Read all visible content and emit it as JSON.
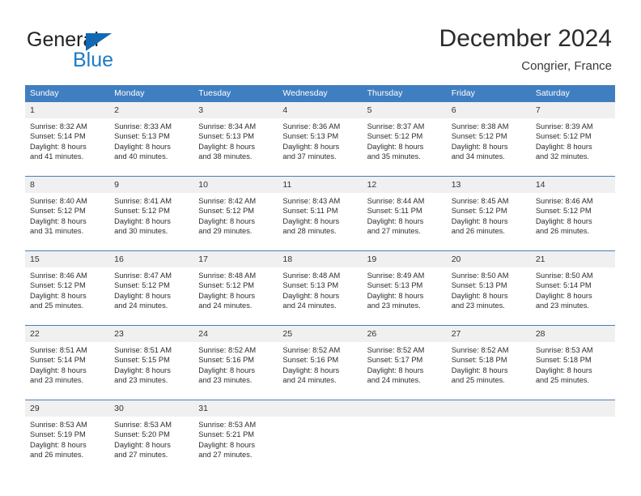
{
  "brand": {
    "name_part1": "General",
    "name_part2": "Blue",
    "accent_color": "#1268b3",
    "logo_icon": "triangle-flag-icon"
  },
  "header": {
    "title": "December 2024",
    "subtitle": "Congrier, France"
  },
  "calendar": {
    "header_bg": "#3f7fc1",
    "daynum_bg": "#f0f0f0",
    "row_border": "#4a7fb5",
    "weekday_headers": [
      "Sunday",
      "Monday",
      "Tuesday",
      "Wednesday",
      "Thursday",
      "Friday",
      "Saturday"
    ],
    "weeks": [
      [
        {
          "day": "1",
          "sunrise": "Sunrise: 8:32 AM",
          "sunset": "Sunset: 5:14 PM",
          "daylight1": "Daylight: 8 hours",
          "daylight2": "and 41 minutes."
        },
        {
          "day": "2",
          "sunrise": "Sunrise: 8:33 AM",
          "sunset": "Sunset: 5:13 PM",
          "daylight1": "Daylight: 8 hours",
          "daylight2": "and 40 minutes."
        },
        {
          "day": "3",
          "sunrise": "Sunrise: 8:34 AM",
          "sunset": "Sunset: 5:13 PM",
          "daylight1": "Daylight: 8 hours",
          "daylight2": "and 38 minutes."
        },
        {
          "day": "4",
          "sunrise": "Sunrise: 8:36 AM",
          "sunset": "Sunset: 5:13 PM",
          "daylight1": "Daylight: 8 hours",
          "daylight2": "and 37 minutes."
        },
        {
          "day": "5",
          "sunrise": "Sunrise: 8:37 AM",
          "sunset": "Sunset: 5:12 PM",
          "daylight1": "Daylight: 8 hours",
          "daylight2": "and 35 minutes."
        },
        {
          "day": "6",
          "sunrise": "Sunrise: 8:38 AM",
          "sunset": "Sunset: 5:12 PM",
          "daylight1": "Daylight: 8 hours",
          "daylight2": "and 34 minutes."
        },
        {
          "day": "7",
          "sunrise": "Sunrise: 8:39 AM",
          "sunset": "Sunset: 5:12 PM",
          "daylight1": "Daylight: 8 hours",
          "daylight2": "and 32 minutes."
        }
      ],
      [
        {
          "day": "8",
          "sunrise": "Sunrise: 8:40 AM",
          "sunset": "Sunset: 5:12 PM",
          "daylight1": "Daylight: 8 hours",
          "daylight2": "and 31 minutes."
        },
        {
          "day": "9",
          "sunrise": "Sunrise: 8:41 AM",
          "sunset": "Sunset: 5:12 PM",
          "daylight1": "Daylight: 8 hours",
          "daylight2": "and 30 minutes."
        },
        {
          "day": "10",
          "sunrise": "Sunrise: 8:42 AM",
          "sunset": "Sunset: 5:12 PM",
          "daylight1": "Daylight: 8 hours",
          "daylight2": "and 29 minutes."
        },
        {
          "day": "11",
          "sunrise": "Sunrise: 8:43 AM",
          "sunset": "Sunset: 5:11 PM",
          "daylight1": "Daylight: 8 hours",
          "daylight2": "and 28 minutes."
        },
        {
          "day": "12",
          "sunrise": "Sunrise: 8:44 AM",
          "sunset": "Sunset: 5:11 PM",
          "daylight1": "Daylight: 8 hours",
          "daylight2": "and 27 minutes."
        },
        {
          "day": "13",
          "sunrise": "Sunrise: 8:45 AM",
          "sunset": "Sunset: 5:12 PM",
          "daylight1": "Daylight: 8 hours",
          "daylight2": "and 26 minutes."
        },
        {
          "day": "14",
          "sunrise": "Sunrise: 8:46 AM",
          "sunset": "Sunset: 5:12 PM",
          "daylight1": "Daylight: 8 hours",
          "daylight2": "and 26 minutes."
        }
      ],
      [
        {
          "day": "15",
          "sunrise": "Sunrise: 8:46 AM",
          "sunset": "Sunset: 5:12 PM",
          "daylight1": "Daylight: 8 hours",
          "daylight2": "and 25 minutes."
        },
        {
          "day": "16",
          "sunrise": "Sunrise: 8:47 AM",
          "sunset": "Sunset: 5:12 PM",
          "daylight1": "Daylight: 8 hours",
          "daylight2": "and 24 minutes."
        },
        {
          "day": "17",
          "sunrise": "Sunrise: 8:48 AM",
          "sunset": "Sunset: 5:12 PM",
          "daylight1": "Daylight: 8 hours",
          "daylight2": "and 24 minutes."
        },
        {
          "day": "18",
          "sunrise": "Sunrise: 8:48 AM",
          "sunset": "Sunset: 5:13 PM",
          "daylight1": "Daylight: 8 hours",
          "daylight2": "and 24 minutes."
        },
        {
          "day": "19",
          "sunrise": "Sunrise: 8:49 AM",
          "sunset": "Sunset: 5:13 PM",
          "daylight1": "Daylight: 8 hours",
          "daylight2": "and 23 minutes."
        },
        {
          "day": "20",
          "sunrise": "Sunrise: 8:50 AM",
          "sunset": "Sunset: 5:13 PM",
          "daylight1": "Daylight: 8 hours",
          "daylight2": "and 23 minutes."
        },
        {
          "day": "21",
          "sunrise": "Sunrise: 8:50 AM",
          "sunset": "Sunset: 5:14 PM",
          "daylight1": "Daylight: 8 hours",
          "daylight2": "and 23 minutes."
        }
      ],
      [
        {
          "day": "22",
          "sunrise": "Sunrise: 8:51 AM",
          "sunset": "Sunset: 5:14 PM",
          "daylight1": "Daylight: 8 hours",
          "daylight2": "and 23 minutes."
        },
        {
          "day": "23",
          "sunrise": "Sunrise: 8:51 AM",
          "sunset": "Sunset: 5:15 PM",
          "daylight1": "Daylight: 8 hours",
          "daylight2": "and 23 minutes."
        },
        {
          "day": "24",
          "sunrise": "Sunrise: 8:52 AM",
          "sunset": "Sunset: 5:16 PM",
          "daylight1": "Daylight: 8 hours",
          "daylight2": "and 23 minutes."
        },
        {
          "day": "25",
          "sunrise": "Sunrise: 8:52 AM",
          "sunset": "Sunset: 5:16 PM",
          "daylight1": "Daylight: 8 hours",
          "daylight2": "and 24 minutes."
        },
        {
          "day": "26",
          "sunrise": "Sunrise: 8:52 AM",
          "sunset": "Sunset: 5:17 PM",
          "daylight1": "Daylight: 8 hours",
          "daylight2": "and 24 minutes."
        },
        {
          "day": "27",
          "sunrise": "Sunrise: 8:52 AM",
          "sunset": "Sunset: 5:18 PM",
          "daylight1": "Daylight: 8 hours",
          "daylight2": "and 25 minutes."
        },
        {
          "day": "28",
          "sunrise": "Sunrise: 8:53 AM",
          "sunset": "Sunset: 5:18 PM",
          "daylight1": "Daylight: 8 hours",
          "daylight2": "and 25 minutes."
        }
      ],
      [
        {
          "day": "29",
          "sunrise": "Sunrise: 8:53 AM",
          "sunset": "Sunset: 5:19 PM",
          "daylight1": "Daylight: 8 hours",
          "daylight2": "and 26 minutes."
        },
        {
          "day": "30",
          "sunrise": "Sunrise: 8:53 AM",
          "sunset": "Sunset: 5:20 PM",
          "daylight1": "Daylight: 8 hours",
          "daylight2": "and 27 minutes."
        },
        {
          "day": "31",
          "sunrise": "Sunrise: 8:53 AM",
          "sunset": "Sunset: 5:21 PM",
          "daylight1": "Daylight: 8 hours",
          "daylight2": "and 27 minutes."
        },
        {
          "day": "",
          "sunrise": "",
          "sunset": "",
          "daylight1": "",
          "daylight2": ""
        },
        {
          "day": "",
          "sunrise": "",
          "sunset": "",
          "daylight1": "",
          "daylight2": ""
        },
        {
          "day": "",
          "sunrise": "",
          "sunset": "",
          "daylight1": "",
          "daylight2": ""
        },
        {
          "day": "",
          "sunrise": "",
          "sunset": "",
          "daylight1": "",
          "daylight2": ""
        }
      ]
    ]
  }
}
